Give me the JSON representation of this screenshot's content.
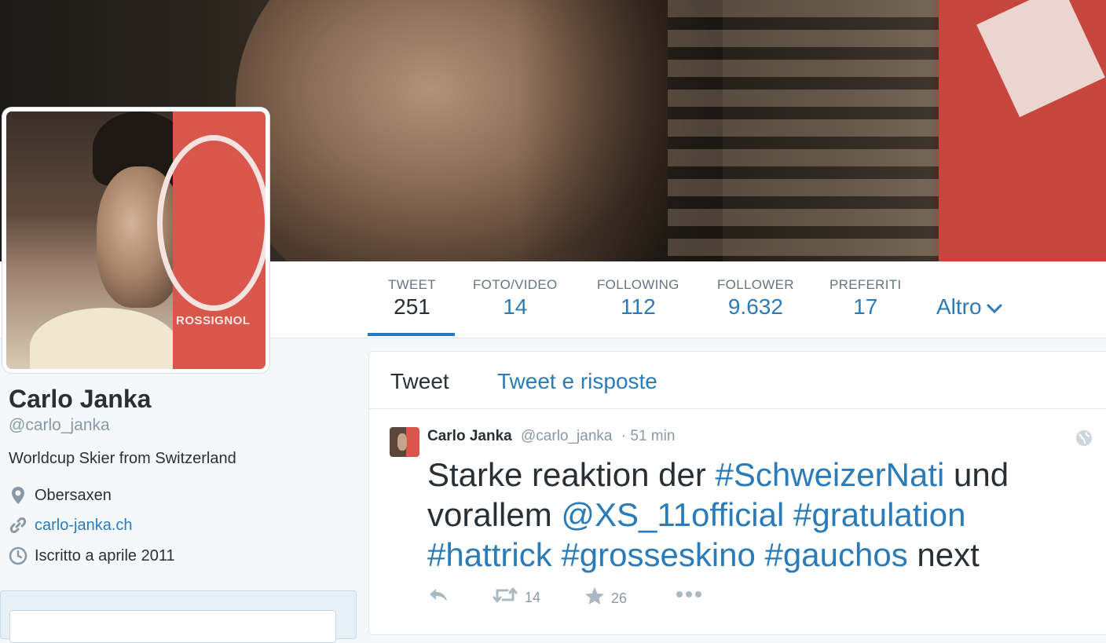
{
  "profile": {
    "name": "Carlo Janka",
    "handle": "@carlo_janka",
    "bio": "Worldcup Skier from Switzerland",
    "location": "Obersaxen",
    "website": "carlo-janka.ch",
    "joined": "Iscritto a aprile 2011",
    "avatar_logo_text": "ROSSIGNOL"
  },
  "stats": [
    {
      "label": "TWEET",
      "value": "251"
    },
    {
      "label": "FOTO/VIDEO",
      "value": "14"
    },
    {
      "label": "FOLLOWING",
      "value": "112"
    },
    {
      "label": "FOLLOWER",
      "value": "9.632"
    },
    {
      "label": "PREFERITI",
      "value": "17"
    }
  ],
  "more_label": "Altro",
  "tabs": {
    "tweets": "Tweet",
    "tweets_replies": "Tweet e risposte"
  },
  "tweet": {
    "author": "Carlo Janka",
    "handle": "@carlo_janka",
    "time": "· 51 min",
    "text_parts": [
      {
        "t": "Starke reaktion der ",
        "k": "plain"
      },
      {
        "t": "#SchweizerNati",
        "k": "tag"
      },
      {
        "t": " und vorallem ",
        "k": "plain"
      },
      {
        "t": "@XS_11official",
        "k": "tag"
      },
      {
        "t": " ",
        "k": "plain"
      },
      {
        "t": "#gratulation",
        "k": "tag"
      },
      {
        "t": " ",
        "k": "plain"
      },
      {
        "t": "#hattrick",
        "k": "tag"
      },
      {
        "t": " ",
        "k": "plain"
      },
      {
        "t": "#grosseskino",
        "k": "tag"
      },
      {
        "t": " ",
        "k": "plain"
      },
      {
        "t": "#gauchos",
        "k": "tag"
      },
      {
        "t": " next",
        "k": "plain"
      }
    ],
    "retweets": "14",
    "favorites": "26"
  },
  "colors": {
    "link": "#2b7bb9",
    "text": "#292f33",
    "muted": "#8899a6",
    "icon": "#aab8c2"
  },
  "icons": {
    "location": "map-pin-icon",
    "website": "link-icon",
    "joined": "clock-icon",
    "more": "chevron-down-icon",
    "globe": "globe-icon",
    "reply": "reply-icon",
    "retweet": "retweet-icon",
    "favorite": "star-icon",
    "menu": "more-dots-icon"
  }
}
